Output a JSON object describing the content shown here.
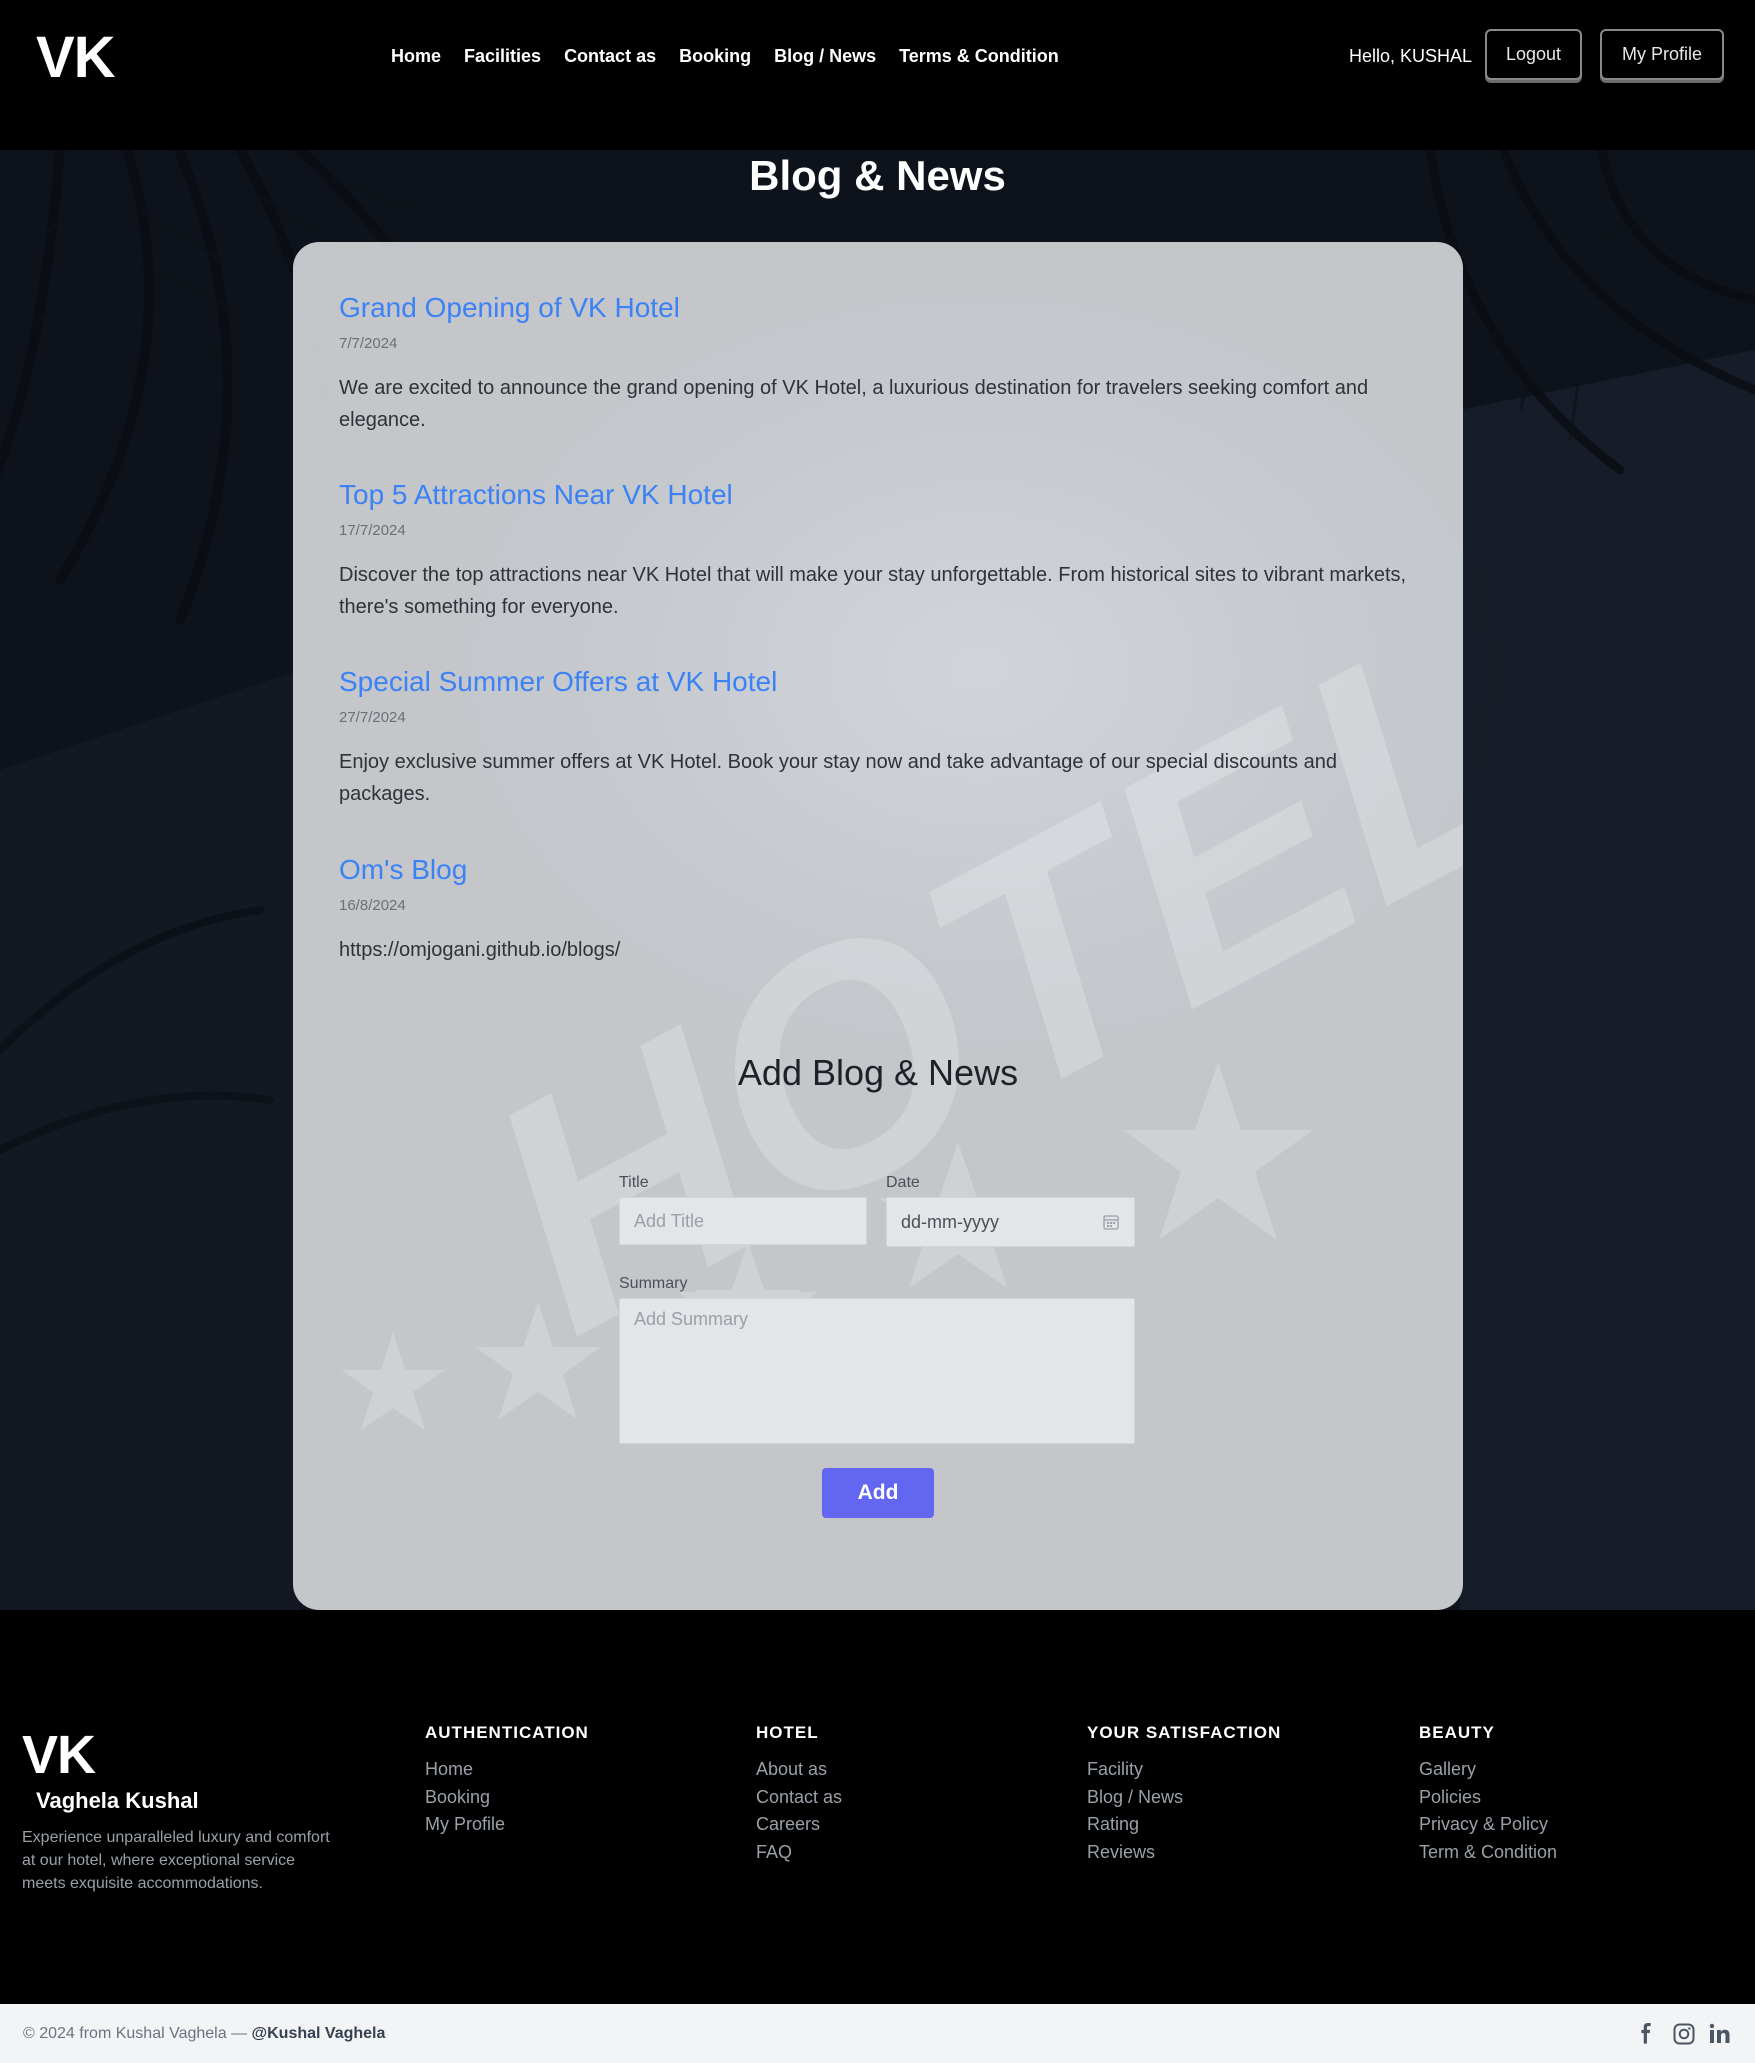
{
  "header": {
    "logo": "VK",
    "nav": [
      "Home",
      "Facilities",
      "Contact as",
      "Booking",
      "Blog / News",
      "Terms & Condition"
    ],
    "greeting": "Hello, KUSHAL",
    "logout_label": "Logout",
    "profile_label": "My Profile"
  },
  "page": {
    "title": "Blog & News"
  },
  "posts": [
    {
      "title": "Grand Opening of VK Hotel",
      "date": "7/7/2024",
      "summary": "We are excited to announce the grand opening of VK Hotel, a luxurious destination for travelers seeking comfort and elegance."
    },
    {
      "title": "Top 5 Attractions Near VK Hotel",
      "date": "17/7/2024",
      "summary": "Discover the top attractions near VK Hotel that will make your stay unforgettable. From historical sites to vibrant markets, there's something for everyone."
    },
    {
      "title": "Special Summer Offers at VK Hotel",
      "date": "27/7/2024",
      "summary": "Enjoy exclusive summer offers at VK Hotel. Book your stay now and take advantage of our special discounts and packages."
    },
    {
      "title": "Om's Blog",
      "date": "16/8/2024",
      "summary": "https://omjogani.github.io/blogs/"
    }
  ],
  "form": {
    "heading": "Add Blog & News",
    "title_label": "Title",
    "title_placeholder": "Add Title",
    "date_label": "Date",
    "date_placeholder": "dd-mm-yyyy",
    "summary_label": "Summary",
    "summary_placeholder": "Add Summary",
    "submit_label": "Add"
  },
  "footer": {
    "logo": "VK",
    "name": "Vaghela Kushal",
    "description": "Experience unparalleled luxury and comfort at our hotel, where exceptional service meets exquisite accommodations.",
    "columns": [
      {
        "heading": "AUTHENTICATION",
        "links": [
          "Home",
          "Booking",
          "My Profile"
        ]
      },
      {
        "heading": "HOTEL",
        "links": [
          "About as",
          "Contact as",
          "Careers",
          "FAQ"
        ]
      },
      {
        "heading": "YOUR SATISFACTION",
        "links": [
          "Facility",
          "Blog / News",
          "Rating",
          "Reviews"
        ]
      },
      {
        "heading": "BEAUTY",
        "links": [
          "Gallery",
          "Policies",
          "Privacy & Policy",
          "Term & Condition"
        ]
      }
    ],
    "copyright": "© 2024 from Kushal Vaghela —",
    "handle": "@Kushal Vaghela",
    "social_icons": [
      "facebook-icon",
      "instagram-icon",
      "linkedin-icon"
    ]
  },
  "colors": {
    "link_blue": "#3b82f6",
    "button_indigo": "#6366f1",
    "header_bg": "#000000",
    "card_bg": "#e2e4e8"
  }
}
